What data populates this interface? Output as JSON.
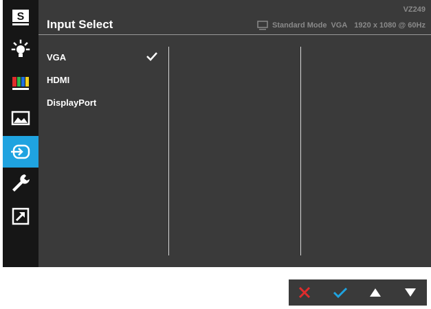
{
  "header": {
    "title": "Input Select",
    "model": "VZ249",
    "mode": "Standard Mode",
    "input": "VGA",
    "resolution": "1920 x 1080 @ 60Hz"
  },
  "sidebar": {
    "items": [
      {
        "icon": "splendid-s-icon"
      },
      {
        "icon": "blue-light-filter-icon"
      },
      {
        "icon": "color-bars-icon"
      },
      {
        "icon": "image-landscape-icon"
      },
      {
        "icon": "input-select-icon",
        "active": true
      },
      {
        "icon": "wrench-icon"
      },
      {
        "icon": "shortcut-arrow-icon"
      }
    ],
    "active_color": "#1fa3e0"
  },
  "inputs": {
    "options": [
      {
        "label": "VGA",
        "selected": true
      },
      {
        "label": "HDMI",
        "selected": false
      },
      {
        "label": "DisplayPort",
        "selected": false
      }
    ]
  },
  "keys": [
    {
      "icon": "close-x-icon",
      "color": "#e02c2c"
    },
    {
      "icon": "check-icon",
      "color": "#1fa3e0"
    },
    {
      "icon": "up-triangle-icon",
      "color": "#ffffff"
    },
    {
      "icon": "down-triangle-icon",
      "color": "#ffffff"
    }
  ]
}
